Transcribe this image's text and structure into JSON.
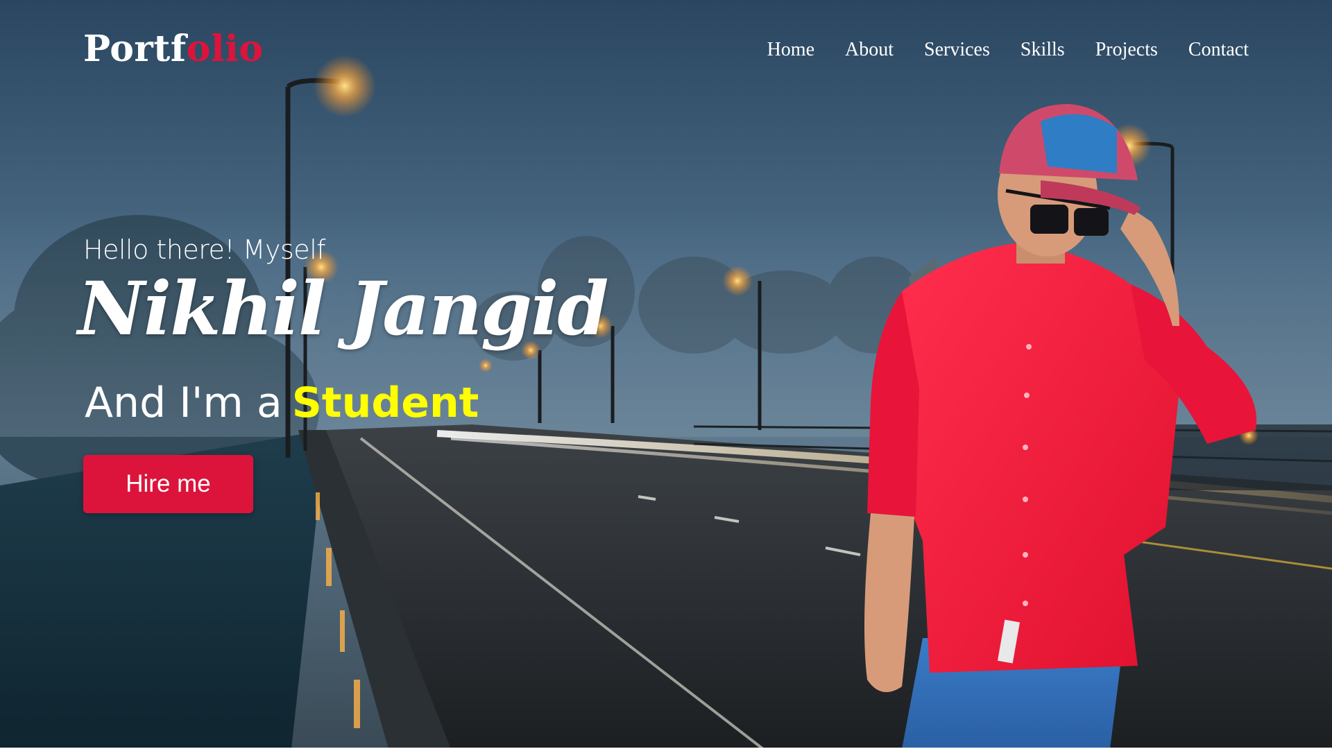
{
  "logo": {
    "prefix": "Portf",
    "accent": "olio"
  },
  "nav": {
    "items": [
      {
        "label": "Home"
      },
      {
        "label": "About"
      },
      {
        "label": "Services"
      },
      {
        "label": "Skills"
      },
      {
        "label": "Projects"
      },
      {
        "label": "Contact"
      }
    ]
  },
  "hero": {
    "intro": "Hello there! Myself",
    "name": "Nikhil Jangid",
    "role_prefix": "And I'm a",
    "role": "Student",
    "hire_label": "Hire me"
  },
  "colors": {
    "accent": "#dc143c",
    "role_highlight": "#ffff00",
    "text": "#ffffff"
  }
}
